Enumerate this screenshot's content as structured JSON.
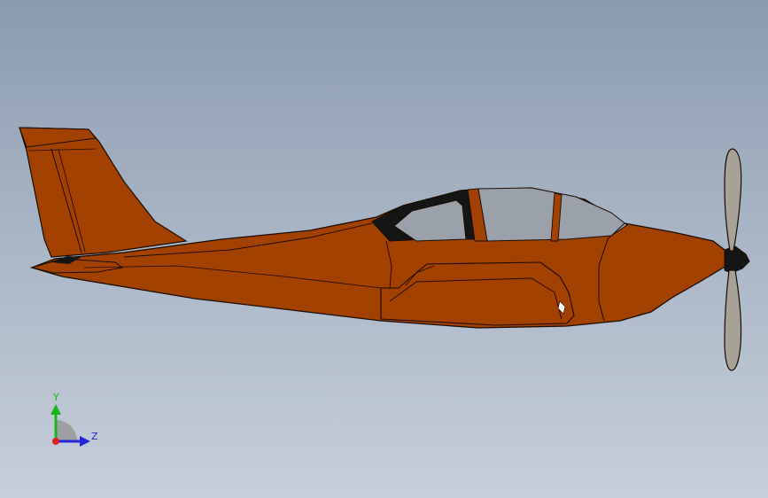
{
  "viewport": {
    "background_top": "#8a9bb0",
    "background_bottom": "#c6cfdb"
  },
  "model": {
    "fuselage_color": "#a34100",
    "canopy_glass_color": "#9aa1aa",
    "canopy_frame_color": "#151515",
    "propeller_color": "#a6a298",
    "outline_color": "#1a0c00"
  },
  "triad": {
    "y_label": "Y",
    "z_label": "Z",
    "y_color": "#1bb51b",
    "z_color": "#2424d8",
    "origin_color": "#e02020"
  }
}
